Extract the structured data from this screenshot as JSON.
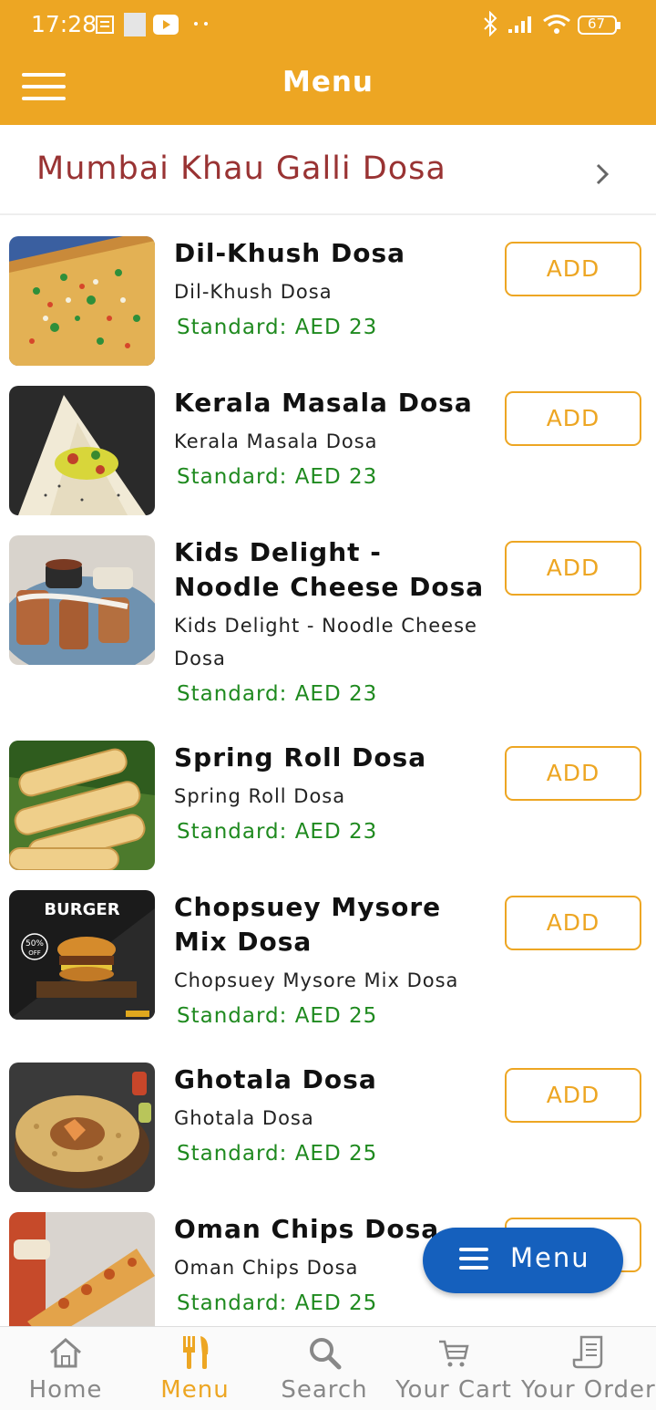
{
  "status_bar": {
    "time": "17:28",
    "battery": "67"
  },
  "app_bar": {
    "title": "Menu"
  },
  "restaurant": {
    "name": "Mumbai Khau Galli Dosa"
  },
  "items": [
    {
      "name": "Dil-Khush Dosa",
      "description": "Dil-Khush Dosa",
      "price": "Standard: AED 23",
      "add_label": "ADD"
    },
    {
      "name": "Kerala Masala Dosa",
      "description": "Kerala Masala Dosa",
      "price": "Standard: AED 23",
      "add_label": "ADD"
    },
    {
      "name": "Kids Delight - Noodle Cheese Dosa",
      "description": "Kids Delight - Noodle Cheese Dosa",
      "price": "Standard: AED 23",
      "add_label": "ADD"
    },
    {
      "name": "Spring Roll Dosa",
      "description": "Spring Roll Dosa",
      "price": "Standard: AED 23",
      "add_label": "ADD"
    },
    {
      "name": "Chopsuey Mysore Mix Dosa",
      "description": "Chopsuey Mysore Mix Dosa",
      "price": "Standard: AED 25",
      "add_label": "ADD"
    },
    {
      "name": "Ghotala Dosa",
      "description": "Ghotala Dosa",
      "price": "Standard: AED 25",
      "add_label": "ADD"
    },
    {
      "name": "Oman Chips Dosa",
      "description": "Oman Chips Dosa",
      "price": "Standard: AED 25",
      "add_label": "ADD"
    }
  ],
  "images": {
    "burger_title": "BURGER",
    "burger_badge": "50%",
    "burger_badge_sub": "OFF"
  },
  "fab": {
    "label": "Menu"
  },
  "bottom_nav": [
    {
      "label": "Home",
      "icon": "home-icon"
    },
    {
      "label": "Menu",
      "icon": "utensils-icon",
      "active": true
    },
    {
      "label": "Search",
      "icon": "search-icon"
    },
    {
      "label": "Your Cart",
      "icon": "cart-icon"
    },
    {
      "label": "Your Orders",
      "icon": "receipt-icon"
    }
  ],
  "colors": {
    "primary": "#EDA623",
    "restaurant_name": "#993333",
    "price": "#1f8a1f",
    "fab": "#1560BD"
  }
}
